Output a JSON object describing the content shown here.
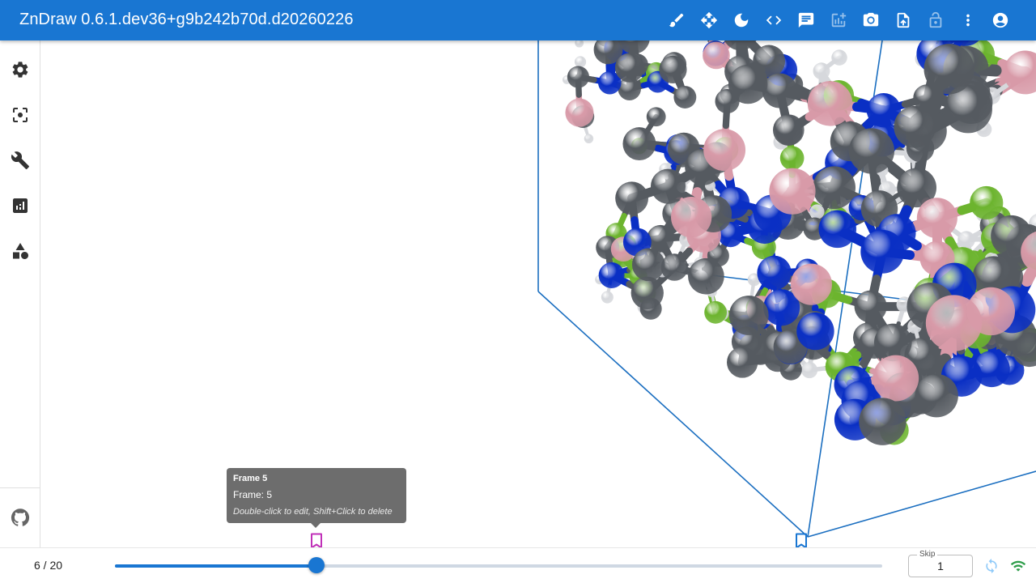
{
  "app": {
    "title": "ZnDraw 0.6.1.dev36+g9b242b70d.d20260226"
  },
  "toolbar": {
    "tools": [
      {
        "icon": "brush-icon",
        "label": "Drawing mode"
      },
      {
        "icon": "move-icon",
        "label": "Move"
      },
      {
        "icon": "dark-mode-icon",
        "label": "Toggle theme"
      },
      {
        "icon": "code-icon",
        "label": "Code"
      },
      {
        "icon": "chat-icon",
        "label": "Chat"
      },
      {
        "icon": "add-chart-icon",
        "label": "Add plot"
      },
      {
        "icon": "camera-icon",
        "label": "Screenshot"
      },
      {
        "icon": "upload-icon",
        "label": "Upload"
      },
      {
        "icon": "lock-icon",
        "label": "Lock"
      },
      {
        "icon": "more-vert-icon",
        "label": "More"
      },
      {
        "icon": "account-icon",
        "label": "Account"
      }
    ]
  },
  "sidebar": {
    "items": [
      {
        "icon": "settings-icon"
      },
      {
        "icon": "focus-icon"
      },
      {
        "icon": "wrench-icon"
      },
      {
        "icon": "analytics-icon"
      },
      {
        "icon": "shapes-icon"
      }
    ],
    "footer_icon": "github-icon"
  },
  "playback": {
    "current_frame": 6,
    "total_frames": 20,
    "frame_label": "6 / 20",
    "progress": 0.263,
    "skip_label": "Skip",
    "skip_value": "1",
    "bookmarks": [
      {
        "frame": 5,
        "active": true
      },
      {
        "frame": 17,
        "active": false
      }
    ]
  },
  "tooltip": {
    "title": "Frame 5",
    "line1": "Frame: 5",
    "hint": "Double-click to edit, Shift+Click to delete"
  },
  "colors": {
    "primary": "#1976d2",
    "bookmark_active": "#c030b8",
    "bookmark_inactive": "#1976d2",
    "connection": "#2e9d4a",
    "carbon": "#555a60",
    "hydrogen": "#d6d8dc",
    "nitrogen": "#0a2fc4",
    "fluorine": "#6cb42e",
    "boron": "#d89aa8",
    "cell": "#1a6ec0"
  }
}
